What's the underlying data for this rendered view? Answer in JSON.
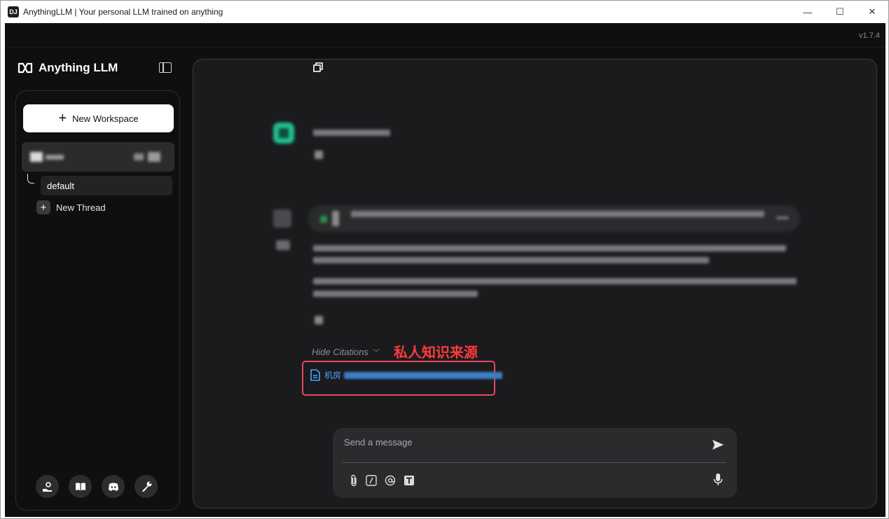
{
  "window": {
    "icon_text": "DJ",
    "title": "AnythingLLM | Your personal LLM trained on anything",
    "minimize": "—",
    "maximize": "☐",
    "close": "✕"
  },
  "app": {
    "version": "v1.7.4",
    "brand": "Anything LLM"
  },
  "sidebar": {
    "new_workspace": "New Workspace",
    "workspace_name": "",
    "thread_default": "default",
    "new_thread": "New Thread",
    "footer_icons": [
      "community-hub-icon",
      "docs-book-icon",
      "discord-icon",
      "settings-wrench-icon"
    ]
  },
  "chat": {
    "hide_citations": "Hide Citations",
    "annotation": "私人知识来源",
    "citation_prefix": "机房"
  },
  "composer": {
    "placeholder": "Send a message",
    "tools": [
      "attach-icon",
      "slash-command-icon",
      "mention-icon",
      "text-size-icon"
    ]
  },
  "colors": {
    "background": "#0e0f0f",
    "panel": "#1b1b1e",
    "accent_annotation": "#ff3b3b",
    "citation_link": "#4da3ff"
  }
}
